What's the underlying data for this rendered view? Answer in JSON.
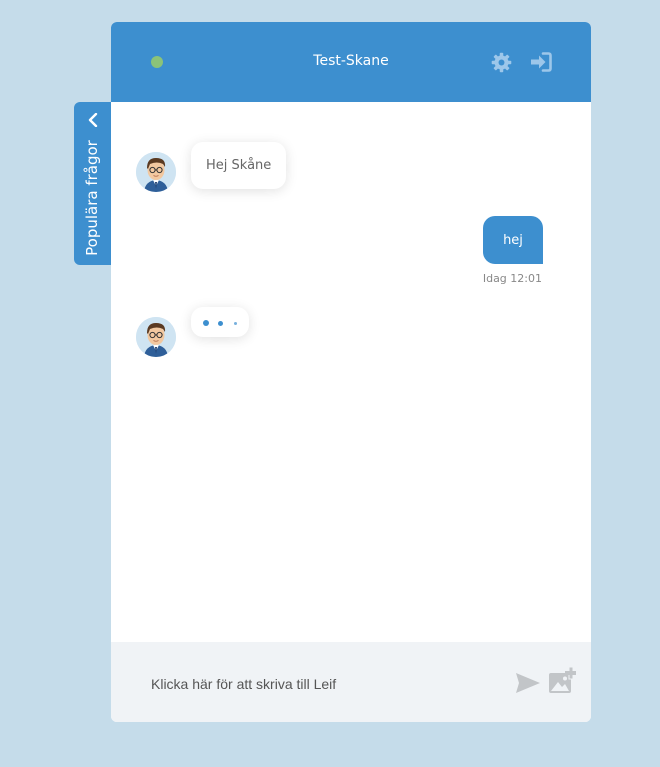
{
  "side_tab": {
    "label": "Populära frågor",
    "icon": "chevron-left-icon"
  },
  "header": {
    "title": "Test-Skane",
    "status_color": "#8bc379",
    "accent_color": "#3d8fcf",
    "icons": [
      "gear-icon",
      "sign-in-icon"
    ]
  },
  "messages": [
    {
      "sender": "bot",
      "avatar": "bot-avatar",
      "text": "Hej Skåne"
    },
    {
      "sender": "user",
      "text": "hej",
      "time": "Idag 12:01"
    },
    {
      "sender": "bot",
      "avatar": "bot-avatar",
      "typing": true
    }
  ],
  "composer": {
    "placeholder": "Klicka här för att skriva till Leif",
    "icons": [
      "send-icon",
      "add-image-icon"
    ]
  }
}
